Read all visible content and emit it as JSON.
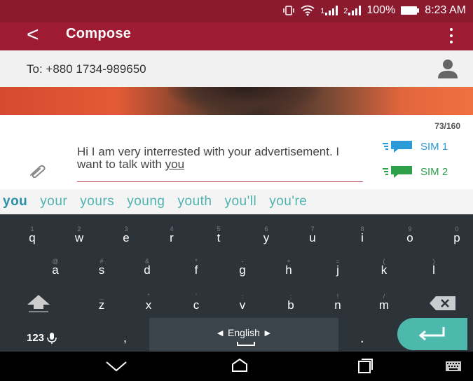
{
  "status_bar": {
    "signal_1": "1",
    "signal_2": "2",
    "battery": "100%",
    "time": "8:23 AM"
  },
  "app_bar": {
    "title": "Compose"
  },
  "recipient": {
    "text": "To: +880 1734-989650"
  },
  "char_counter": "73/160",
  "message": {
    "value": "Hi I am very interrested with your advertisement. I want to talk with you"
  },
  "sim_buttons": [
    {
      "label": "SIM 1",
      "color": "#2a9ad8"
    },
    {
      "label": "SIM 2",
      "color": "#2ea04a"
    }
  ],
  "suggestions": [
    "you",
    "your",
    "yours",
    "young",
    "youth",
    "you'll",
    "you're"
  ],
  "keyboard": {
    "row1": [
      {
        "k": "q",
        "h": "1"
      },
      {
        "k": "w",
        "h": "2"
      },
      {
        "k": "e",
        "h": "3"
      },
      {
        "k": "r",
        "h": "4"
      },
      {
        "k": "t",
        "h": "5"
      },
      {
        "k": "y",
        "h": "6"
      },
      {
        "k": "u",
        "h": "7"
      },
      {
        "k": "i",
        "h": "8"
      },
      {
        "k": "o",
        "h": "9"
      },
      {
        "k": "p",
        "h": "0"
      }
    ],
    "row2": [
      {
        "k": "a",
        "h": "@"
      },
      {
        "k": "s",
        "h": "#"
      },
      {
        "k": "d",
        "h": "&"
      },
      {
        "k": "f",
        "h": "*"
      },
      {
        "k": "g",
        "h": "-"
      },
      {
        "k": "h",
        "h": "+"
      },
      {
        "k": "j",
        "h": "="
      },
      {
        "k": "k",
        "h": "("
      },
      {
        "k": "l",
        "h": ")"
      }
    ],
    "row3": [
      {
        "k": "z",
        "h": "_"
      },
      {
        "k": "x",
        "h": "\""
      },
      {
        "k": "c",
        "h": "'"
      },
      {
        "k": "v",
        "h": ":"
      },
      {
        "k": "b",
        "h": ";"
      },
      {
        "k": "n",
        "h": "!"
      },
      {
        "k": "m",
        "h": "/"
      }
    ],
    "numbers_label": "123",
    "comma": ",",
    "period": ".",
    "language": "English"
  },
  "colors": {
    "accent": "#9e1b33",
    "keyboard_bg": "#2c3339",
    "enter": "#4db8ac",
    "suggest_text": "#4db3b0"
  },
  "icons": {
    "back": "back-arrow-icon",
    "menu": "overflow-menu-icon",
    "contact": "contact-person-icon",
    "attach": "paperclip-icon",
    "shift": "shift-icon",
    "backspace": "backspace-icon",
    "mic": "microphone-icon",
    "enter": "enter-icon",
    "nav_back": "nav-back-icon",
    "nav_home": "nav-home-icon",
    "nav_recents": "nav-recents-icon",
    "nav_keyboard": "keyboard-switch-icon"
  }
}
